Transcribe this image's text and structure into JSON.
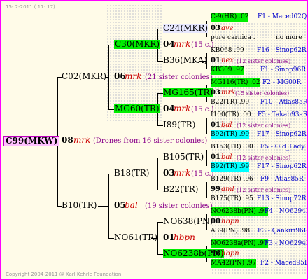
{
  "header": {
    "date": "15-  2-2011 ( 17: 17)"
  },
  "root": {
    "id": "C99(MKW)"
  },
  "gen1_dam": {
    "id": "C02(MKR)",
    "year": "08",
    "breed": "mrk",
    "info": "(Drones from 16 sister colonies)"
  },
  "gen1_sire": {
    "id": "B10(TR)"
  },
  "g2a": {
    "id": "C30(MKR)",
    "year": "06",
    "breed": "mrk",
    "info": "(21 sister colonies)"
  },
  "g2b": {
    "id": "MG60(TR)"
  },
  "g2c": {
    "id": "B18(TR)",
    "year": "05",
    "breed": "bal",
    "info": "(19 sister colonies)"
  },
  "g2d": {
    "id": "NO61(TR)"
  },
  "g3": [
    {
      "id": "C24(MKR)"
    },
    {
      "year": "04",
      "breed": "mrk",
      "info": "(15 c.)"
    },
    {
      "id": "B36(MKA)"
    },
    {
      "id": "MG165(TR)"
    },
    {
      "year": "04",
      "breed": "mrk",
      "info": "(15 c.)"
    },
    {
      "id": "I89(TR)"
    },
    {
      "id": "B105(TR)"
    },
    {
      "year": "03",
      "breed": "mrk",
      "info": "(15 c.)"
    },
    {
      "id": "B22(TR)"
    },
    {
      "id": "NO638(PN)"
    },
    {
      "year": "01",
      "breed": "hbpn"
    },
    {
      "id": "NO6238b(PN)"
    }
  ],
  "g4": [
    {
      "id": "C-9(HR) .02",
      "loc": "F1 - Maced02Q"
    },
    {
      "year": "03",
      "breed": "ave"
    },
    {
      "id": "pure carnica .",
      "loc": "no more"
    },
    {
      "id": "KB068 .99",
      "loc": "F16 - Sinop62R"
    },
    {
      "year": "01",
      "breed": "nex",
      "info": "(12 sister colonies)"
    },
    {
      "id": "KB309 .97",
      "loc": "F1 - Sinop96R"
    },
    {
      "id": "MG116(TR) .02",
      "loc": "F2 - MG00R"
    },
    {
      "year": "03",
      "breed": "mrk",
      "info": "(15 sister colonies)"
    },
    {
      "id": "B22(TR) .99",
      "loc": "F10 - Atlas85R"
    },
    {
      "id": "I100(TR) .00",
      "loc": "F5 - Takab93aR"
    },
    {
      "year": "01",
      "breed": "bal",
      "info": "(12 sister colonies)"
    },
    {
      "id": "B92(TR) .99",
      "loc": "F17 - Sinop62R"
    },
    {
      "id": "B153(TR) .00",
      "loc": "F5 - Old_Lady"
    },
    {
      "year": "01",
      "breed": "bal",
      "info": "(12 sister colonies)"
    },
    {
      "id": "B92(TR) .99",
      "loc": "F17 - Sinop62R"
    },
    {
      "id": "B129(TR) .96",
      "loc": "F9 - Atlas85R"
    },
    {
      "year": "99",
      "breed": "aml",
      "info": "(12 sister colonies)"
    },
    {
      "id": "B175(TR) .95",
      "loc": "F13 - Sinop72R"
    },
    {
      "id": "NO6238b(PN) .98",
      "loc": "F4 - NO6294R"
    },
    {
      "year": "00",
      "breed": "hbpn"
    },
    {
      "id": "A39(PN) .98",
      "loc": "F3 - Çankiri96R"
    },
    {
      "id": "NO6238a(PN) .97",
      "loc": "F3 - NO6294R"
    },
    {
      "year": "98",
      "breed": "hbpn"
    },
    {
      "id": "MA42(PN) .97",
      "loc": "F2 - Maced95R"
    }
  ],
  "footer": {
    "copyright": "Copyright 2004-2011 @ Karl Kehrle Foundation"
  }
}
